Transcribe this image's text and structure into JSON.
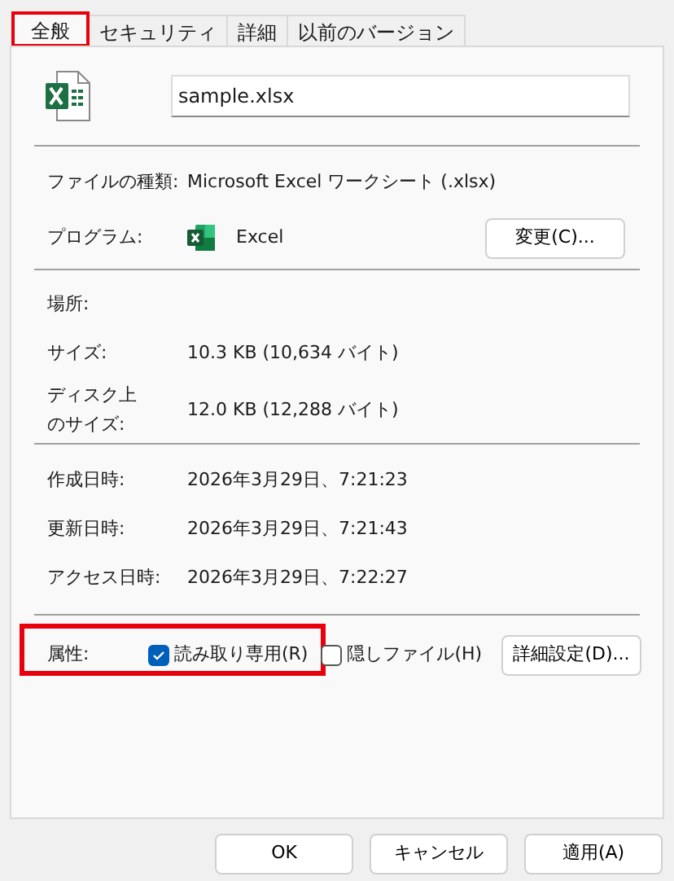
{
  "tabs": [
    {
      "label": "全般",
      "selected": true,
      "highlighted": true
    },
    {
      "label": "セキュリティ",
      "selected": false,
      "highlighted": false
    },
    {
      "label": "詳細",
      "selected": false,
      "highlighted": false
    },
    {
      "label": "以前のバージョン",
      "selected": false,
      "highlighted": false
    }
  ],
  "file_name": "sample.xlsx",
  "type_section": [
    {
      "label": "ファイルの種類:",
      "value": "Microsoft Excel ワークシート (.xlsx)"
    },
    {
      "label": "プログラム:",
      "value": "Excel",
      "button": "変更(C)..."
    }
  ],
  "size_section": [
    {
      "label": "場所:"
    },
    {
      "label": "サイズ:",
      "value": "10.3 KB (10,634 バイト)"
    },
    {
      "label_lines": [
        "ディスク上",
        "のサイズ:"
      ],
      "value": "12.0 KB (12,288 バイト)"
    }
  ],
  "date_section": [
    {
      "label": "作成日時:",
      "value": "2026年3月29日、7:21:23"
    },
    {
      "label": "更新日時:",
      "value": "2026年3月29日、7:21:43"
    },
    {
      "label": "アクセス日時:",
      "value": "2026年3月29日、7:22:27"
    }
  ],
  "attributes": {
    "label": "属性:",
    "highlighted": true,
    "checkboxes": [
      {
        "label": "読み取り専用(R)",
        "checked": true
      },
      {
        "label": "隠しファイル(H)",
        "checked": false
      }
    ],
    "button": "詳細設定(D)..."
  },
  "footer_buttons": [
    "OK",
    "キャンセル",
    "適用(A)"
  ]
}
